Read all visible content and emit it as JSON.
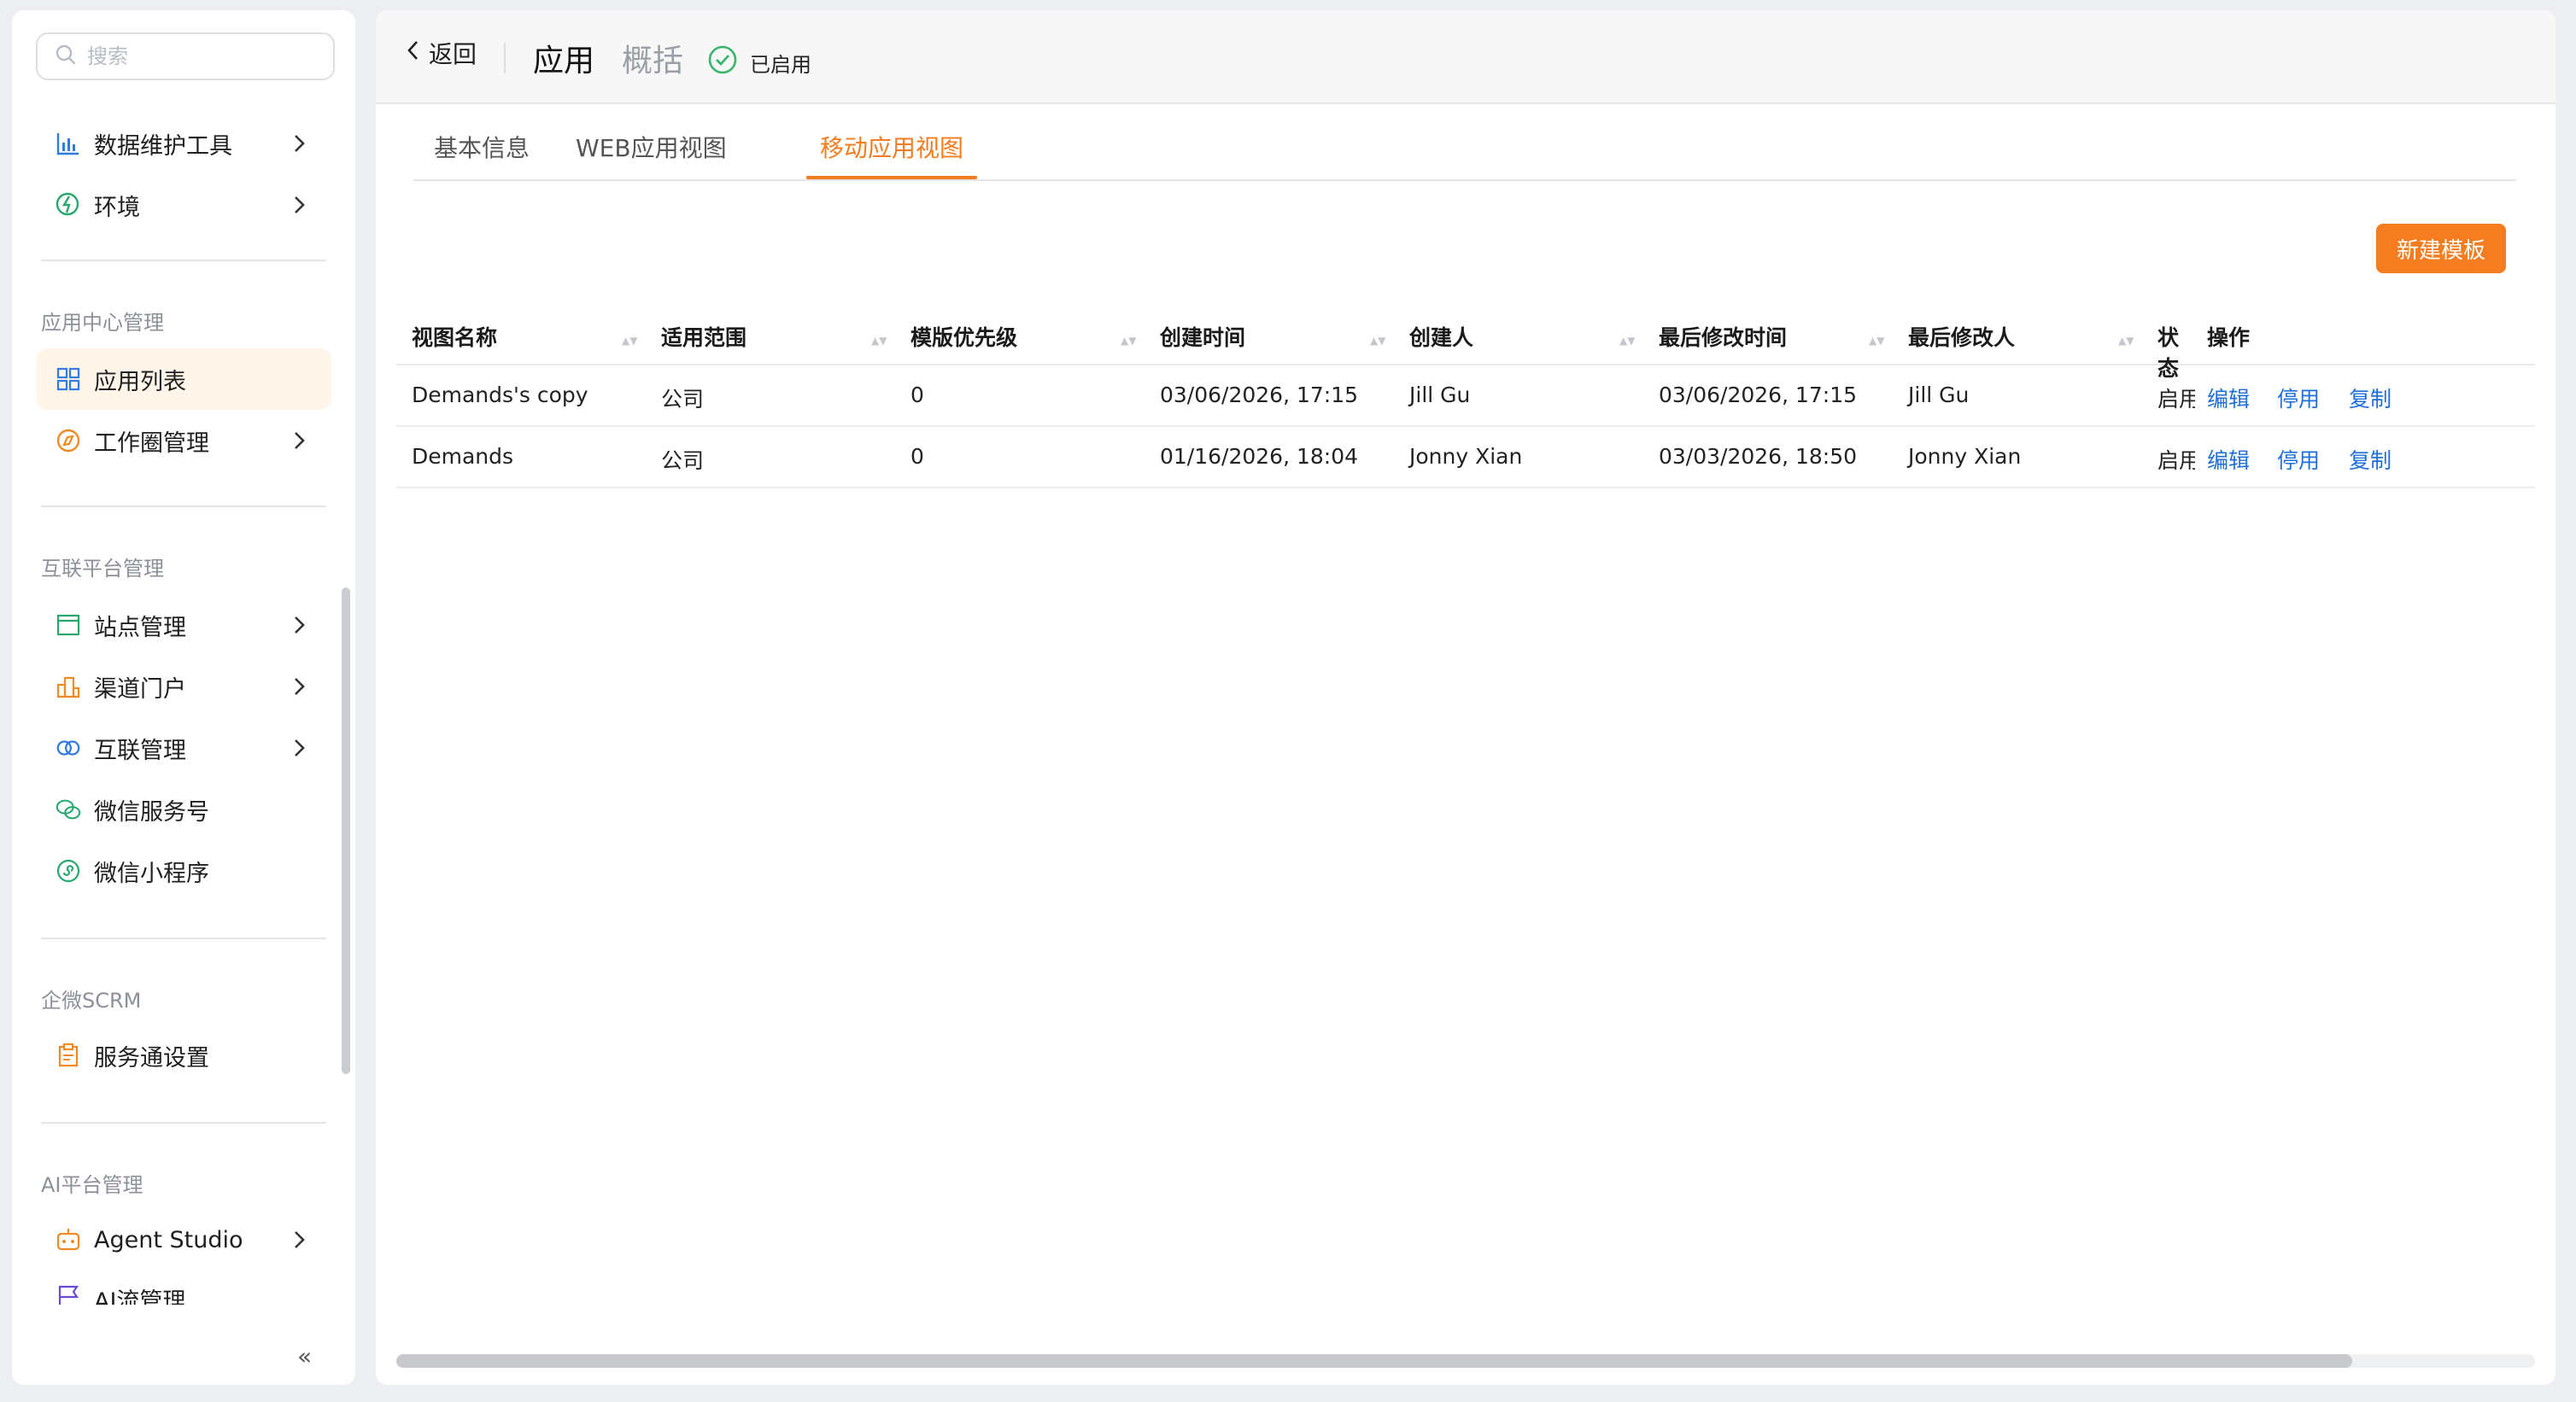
{
  "sidebar": {
    "search_placeholder": "搜索",
    "group0": [
      {
        "label": "数据维护工具",
        "icon": "bar-chart-icon",
        "has_chevron": true
      },
      {
        "label": "环境",
        "icon": "environment-icon",
        "has_chevron": true
      }
    ],
    "section1_title": "应用中心管理",
    "group1": [
      {
        "label": "应用列表",
        "icon": "grid-icon",
        "active": true
      },
      {
        "label": "工作圈管理",
        "icon": "compass-icon",
        "has_chevron": true
      }
    ],
    "section2_title": "互联平台管理",
    "group2": [
      {
        "label": "站点管理",
        "icon": "site-icon",
        "has_chevron": true
      },
      {
        "label": "渠道门户",
        "icon": "building-icon",
        "has_chevron": true
      },
      {
        "label": "互联管理",
        "icon": "link-rings-icon",
        "has_chevron": true
      },
      {
        "label": "微信服务号",
        "icon": "wechat-icon"
      },
      {
        "label": "微信小程序",
        "icon": "mini-program-icon"
      }
    ],
    "section3_title": "企微SCRM",
    "group3": [
      {
        "label": "服务通设置",
        "icon": "clipboard-icon"
      }
    ],
    "section4_title": "AI平台管理",
    "group4": [
      {
        "label": "Agent Studio",
        "icon": "robot-icon",
        "has_chevron": true
      },
      {
        "label": "AI流管理",
        "icon": "flag-icon"
      }
    ],
    "collapse_glyph": "«"
  },
  "header": {
    "back_label": "返回",
    "title": "应用",
    "subtitle": "概括",
    "status": "已启用"
  },
  "tabs": [
    {
      "label": "基本信息"
    },
    {
      "label": "WEB应用视图"
    },
    {
      "label": "移动应用视图",
      "active": true
    }
  ],
  "new_template_button": "新建模板",
  "table": {
    "columns": [
      "视图名称",
      "适用范围",
      "模版优先级",
      "创建时间",
      "创建人",
      "最后修改时间",
      "最后修改人",
      "状态",
      "操作"
    ],
    "rows": [
      {
        "name": "Demands's copy",
        "scope": "公司",
        "priority": "0",
        "created": "03/06/2026, 17:15",
        "creator": "Jill Gu",
        "modified": "03/06/2026, 17:15",
        "modifier": "Jill Gu",
        "status": "启用",
        "actions": [
          "编辑",
          "停用",
          "复制"
        ]
      },
      {
        "name": "Demands",
        "scope": "公司",
        "priority": "0",
        "created": "01/16/2026, 18:04",
        "creator": "Jonny Xian",
        "modified": "03/03/2026, 18:50",
        "modifier": "Jonny Xian",
        "status": "启用",
        "actions": [
          "编辑",
          "停用",
          "复制"
        ]
      }
    ]
  },
  "colors": {
    "accent": "#f47c20",
    "link": "#1e6fd9",
    "active_bg": "#fff5e9",
    "success": "#3bb56b"
  }
}
